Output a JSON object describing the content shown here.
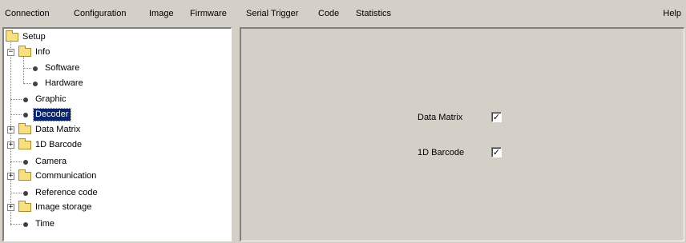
{
  "menu": {
    "items": [
      "Connection",
      "Configuration",
      "Image",
      "Firmware",
      "Serial Trigger",
      "Code",
      "Statistics"
    ],
    "help": "Help"
  },
  "tree": {
    "root": "Setup",
    "info": "Info",
    "software": "Software",
    "hardware": "Hardware",
    "graphic": "Graphic",
    "decoder": "Decoder",
    "data_matrix": "Data Matrix",
    "barcode_1d": "1D Barcode",
    "camera": "Camera",
    "communication": "Communication",
    "reference_code": "Reference code",
    "image_storage": "Image storage",
    "time": "Time",
    "expander_collapsed": "+",
    "expander_expanded": "−"
  },
  "decoder_panel": {
    "data_matrix_label": "Data Matrix",
    "data_matrix_checked": true,
    "barcode_1d_label": "1D Barcode",
    "barcode_1d_checked": true,
    "check_glyph": "✓"
  },
  "colors": {
    "selection": "#0a246a",
    "folder": "#f7e083",
    "panel": "#d4d0c8"
  }
}
